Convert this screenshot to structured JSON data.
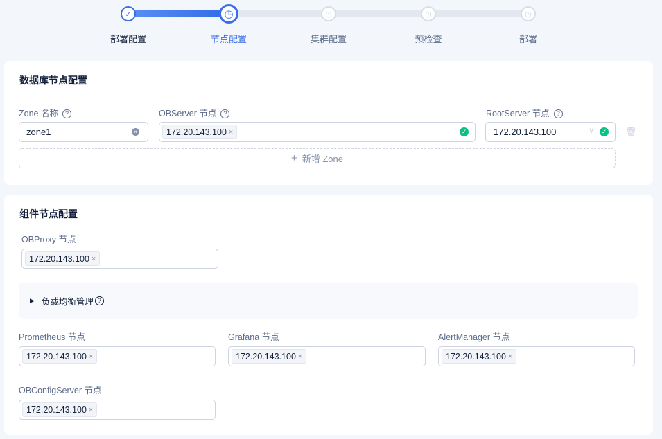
{
  "steps": [
    {
      "label": "部署配置",
      "state": "done"
    },
    {
      "label": "节点配置",
      "state": "current"
    },
    {
      "label": "集群配置",
      "state": "todo"
    },
    {
      "label": "预检查",
      "state": "todo"
    },
    {
      "label": "部署",
      "state": "todo"
    }
  ],
  "db": {
    "title": "数据库节点配置",
    "zone_label": "Zone 名称",
    "observer_label": "OBServer 节点",
    "rootserver_label": "RootServer 节点",
    "zone_value": "zone1",
    "observer_tag": "172.20.143.100",
    "rootserver_value": "172.20.143.100",
    "add_zone": "新增 Zone"
  },
  "comp": {
    "title": "组件节点配置",
    "obproxy_label": "OBProxy 节点",
    "obproxy_tag": "172.20.143.100",
    "lb_label": "负载均衡管理",
    "prometheus_label": "Prometheus 节点",
    "prometheus_tag": "172.20.143.100",
    "grafana_label": "Grafana 节点",
    "grafana_tag": "172.20.143.100",
    "alertmanager_label": "AlertManager 节点",
    "alertmanager_tag": "172.20.143.100",
    "obconfig_label": "OBConfigServer 节点",
    "obconfig_tag": "172.20.143.100"
  },
  "colors": {
    "primary": "#3b6ee6",
    "success": "#0ac185"
  }
}
